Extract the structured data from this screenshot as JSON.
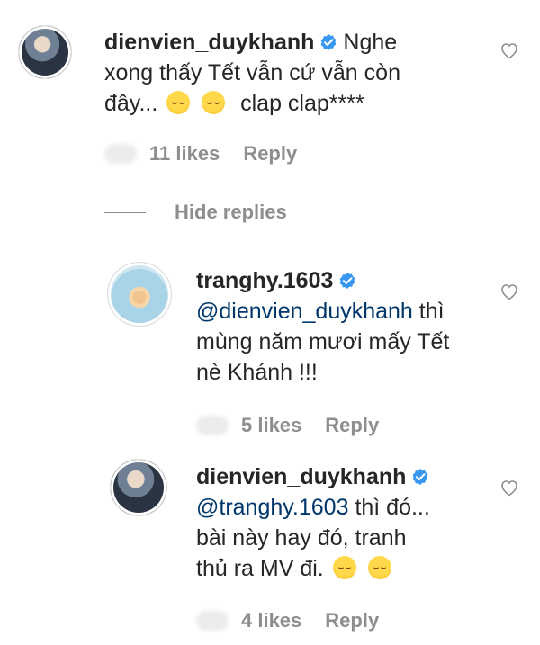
{
  "comments": [
    {
      "username": "dienvien_duykhanh",
      "text_line1": "Nghe",
      "text_line2": "xong thấy Tết vẫn cứ vẫn còn",
      "text_line3_prefix": "đây...",
      "text_line3_suffix": "clap clap****",
      "likes": "11 likes",
      "reply": "Reply"
    },
    {
      "username": "tranghy.1603",
      "mention": "@dienvien_duykhanh",
      "text_line1_suffix": "thì",
      "text_line2": "mùng năm mươi mấy Tết",
      "text_line3": "nè Khánh !!!",
      "likes": "5 likes",
      "reply": "Reply"
    },
    {
      "username": "dienvien_duykhanh",
      "mention": "@tranghy.1603",
      "text_line1_suffix": "thì đó...",
      "text_line2": "bài này hay đó, tranh",
      "text_line3_prefix": "thủ ra MV đi.",
      "likes": "4 likes",
      "reply": "Reply"
    }
  ],
  "hide_replies": "Hide replies",
  "colors": {
    "verified": "#3897f0",
    "muted": "#8e8e8e",
    "mention": "#00376b"
  },
  "icons": [
    "verified-badge-icon",
    "heart-icon",
    "emoji-relieved-icon"
  ]
}
